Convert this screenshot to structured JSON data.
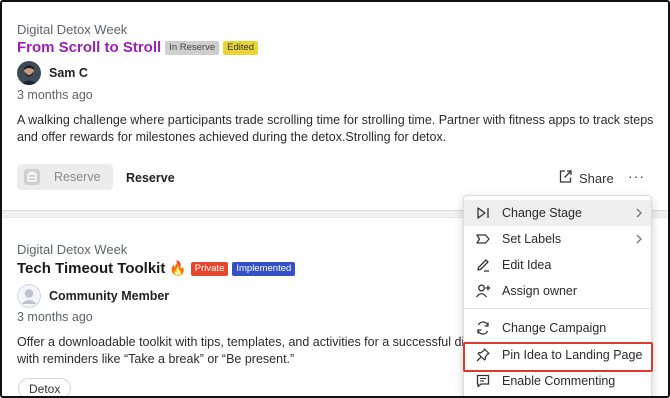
{
  "ideas": [
    {
      "campaign": "Digital Detox Week",
      "title": "From Scroll to Stroll",
      "tags": [
        "In Reserve",
        "Edited"
      ],
      "author": "Sam C",
      "time": "3 months ago",
      "description": "A walking challenge where participants trade scrolling time for strolling time. Partner with fitness apps to track steps and offer rewards for milestones achieved during the detox.Strolling for detox."
    },
    {
      "campaign": "Digital Detox Week",
      "title": "Tech Timeout Toolkit",
      "title_emoji": "🔥",
      "tags": [
        "Private",
        "Implemented"
      ],
      "author": "Community Member",
      "time": "3 months ago",
      "description_line1": "Offer a downloadable toolkit with tips, templates, and activities for a successful digita",
      "description_line2": "with reminders like “Take a break” or “Be present.”",
      "chip": "Detox"
    }
  ],
  "actions": {
    "reserve_button": "Reserve",
    "reserve_link": "Reserve",
    "share": "Share",
    "more": "···"
  },
  "menu": {
    "items": [
      {
        "label": "Change Stage",
        "icon": "play-next-icon",
        "submenu": true
      },
      {
        "label": "Set Labels",
        "icon": "label-icon",
        "submenu": true
      },
      {
        "label": "Edit Idea",
        "icon": "pencil-icon"
      },
      {
        "label": "Assign owner",
        "icon": "add-user-icon"
      },
      {
        "label": "Change Campaign",
        "icon": "refresh-icon"
      },
      {
        "label": "Pin Idea to Landing Page",
        "icon": "pin-icon"
      },
      {
        "label": "Enable Commenting",
        "icon": "comment-icon"
      }
    ]
  },
  "colors": {
    "title_purple": "#9a1fb4",
    "edited_tag": "#e7d534",
    "private_tag": "#e4472c",
    "implemented_tag": "#3450c4",
    "highlight_box": "#e0392a"
  }
}
